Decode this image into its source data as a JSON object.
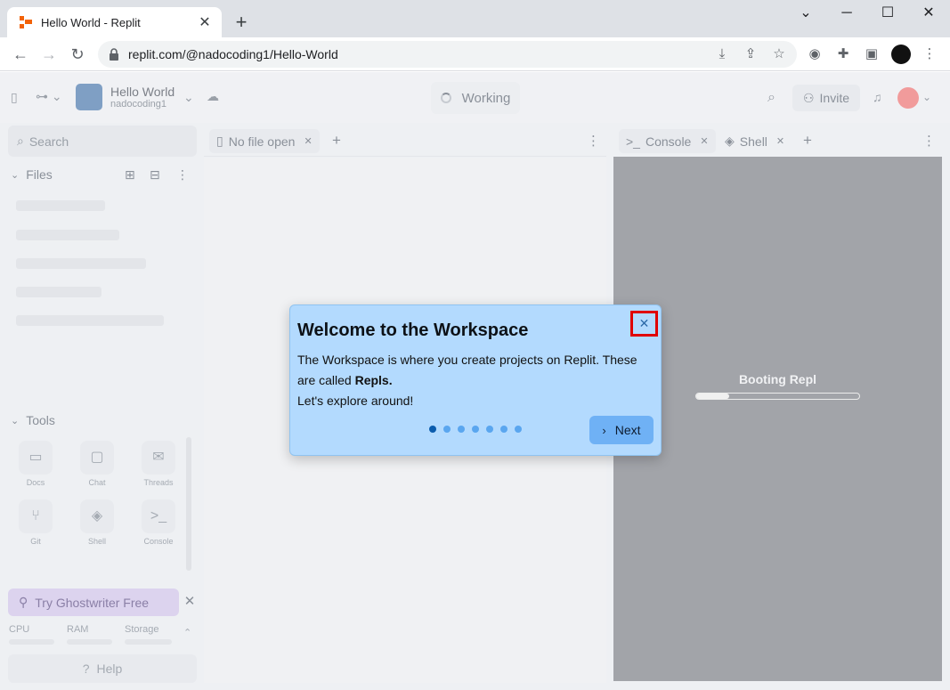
{
  "browser": {
    "tab_title": "Hello World - Replit",
    "new_tab": "+",
    "url": "replit.com/@nadocoding1/Hello-World",
    "window": {
      "minimize": "─",
      "maximize": "☐",
      "close": "✕",
      "tab_list": "⌄"
    }
  },
  "replit": {
    "repl_name": "Hello World",
    "repl_owner": "nadocoding1",
    "status": "Working",
    "invite_label": "Invite"
  },
  "sidebar": {
    "search_placeholder": "Search",
    "files_label": "Files",
    "tools_label": "Tools",
    "tools": [
      {
        "label": "Docs",
        "icon": "docs-icon"
      },
      {
        "label": "Chat",
        "icon": "chat-icon"
      },
      {
        "label": "Threads",
        "icon": "threads-icon"
      },
      {
        "label": "Git",
        "icon": "git-icon"
      },
      {
        "label": "Shell",
        "icon": "shell-icon"
      },
      {
        "label": "Console",
        "icon": "console-icon"
      }
    ],
    "ghostwriter_label": "Try Ghostwriter Free",
    "resources": {
      "cpu": "CPU",
      "ram": "RAM",
      "storage": "Storage"
    },
    "help_label": "Help"
  },
  "editor": {
    "tab_label": "No file open"
  },
  "console": {
    "tabs": [
      {
        "label": "Console",
        "icon": "terminal-icon"
      },
      {
        "label": "Shell",
        "icon": "shell-icon"
      }
    ],
    "booting_label": "Booting Repl",
    "booting_progress": 0.2
  },
  "welcome": {
    "title": "Welcome to the Workspace",
    "body_1": "The Workspace is where you create projects on Replit. These are called ",
    "body_bold": "Repls.",
    "body_2": "Let's explore around!",
    "next_label": "Next",
    "dots_total": 7,
    "dots_active": 0,
    "colors": {
      "active_dot": "#0b5cad",
      "inactive_dot": "#5aa6ef",
      "highlight": "#e00000"
    }
  }
}
